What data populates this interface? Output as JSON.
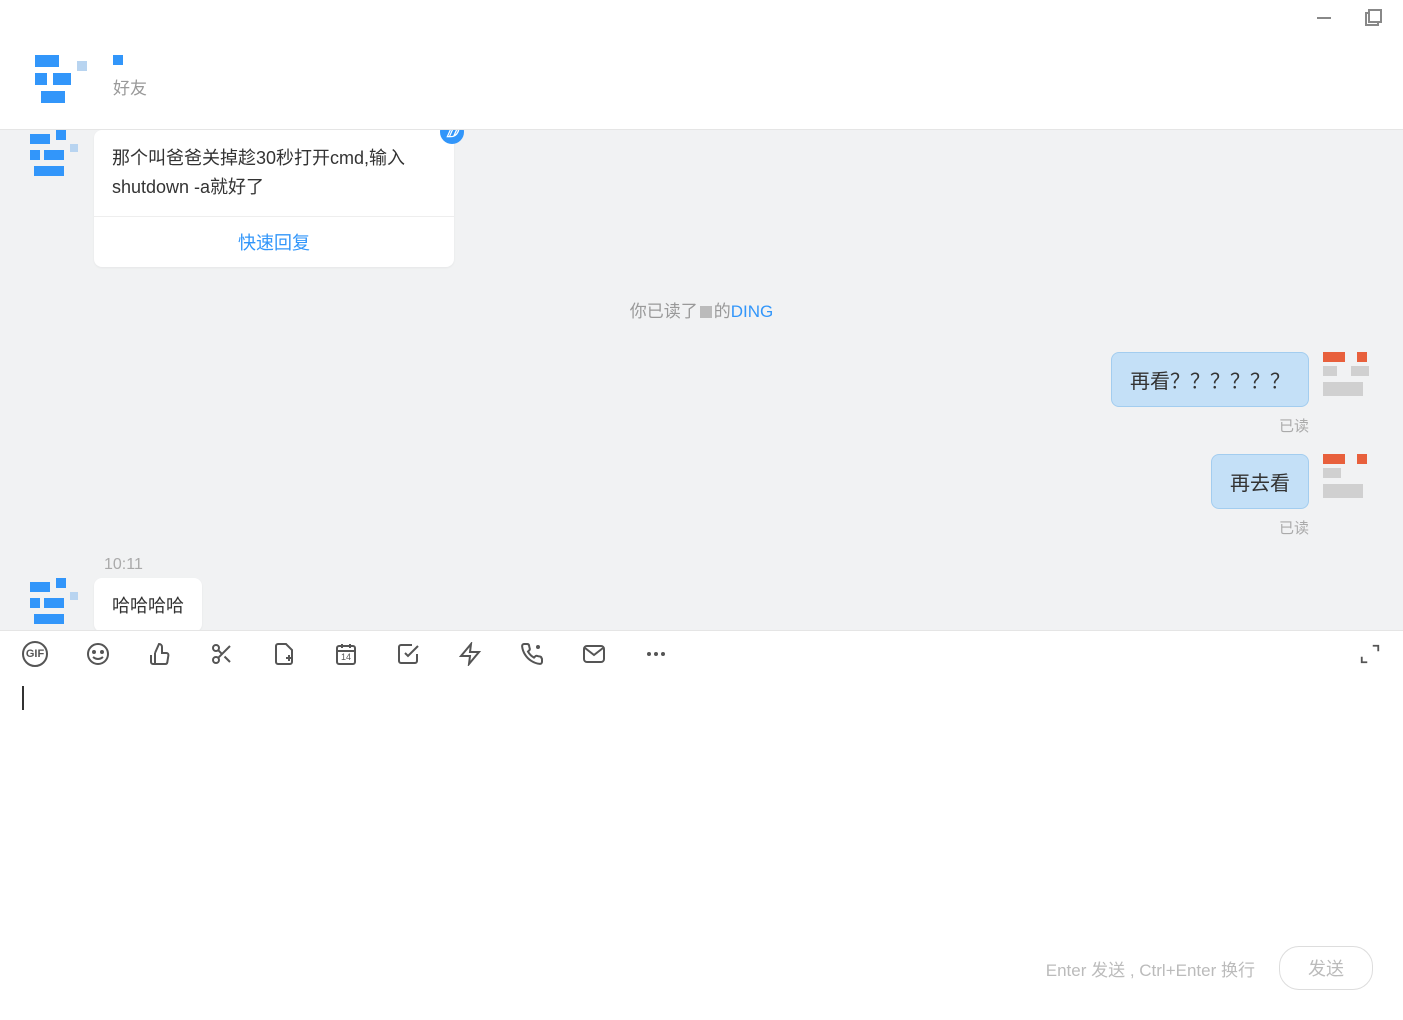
{
  "header": {
    "subtitle": "好友"
  },
  "messages": {
    "card": {
      "text": "那个叫爸爸关掉趁30秒打开cmd,输入shutdown -a就好了",
      "action": "快速回复"
    },
    "ding": {
      "prefix": "你已读了",
      "suffix": "的",
      "link": "DING"
    },
    "right1": {
      "text": "再看？？？？？？",
      "status": "已读"
    },
    "right2": {
      "text": "再去看",
      "status": "已读"
    },
    "left2": {
      "time": "10:11",
      "text": "哈哈哈哈"
    }
  },
  "toolbar": {
    "gif": "GIF"
  },
  "footer": {
    "hint": "Enter 发送 , Ctrl+Enter 换行",
    "send": "发送"
  }
}
